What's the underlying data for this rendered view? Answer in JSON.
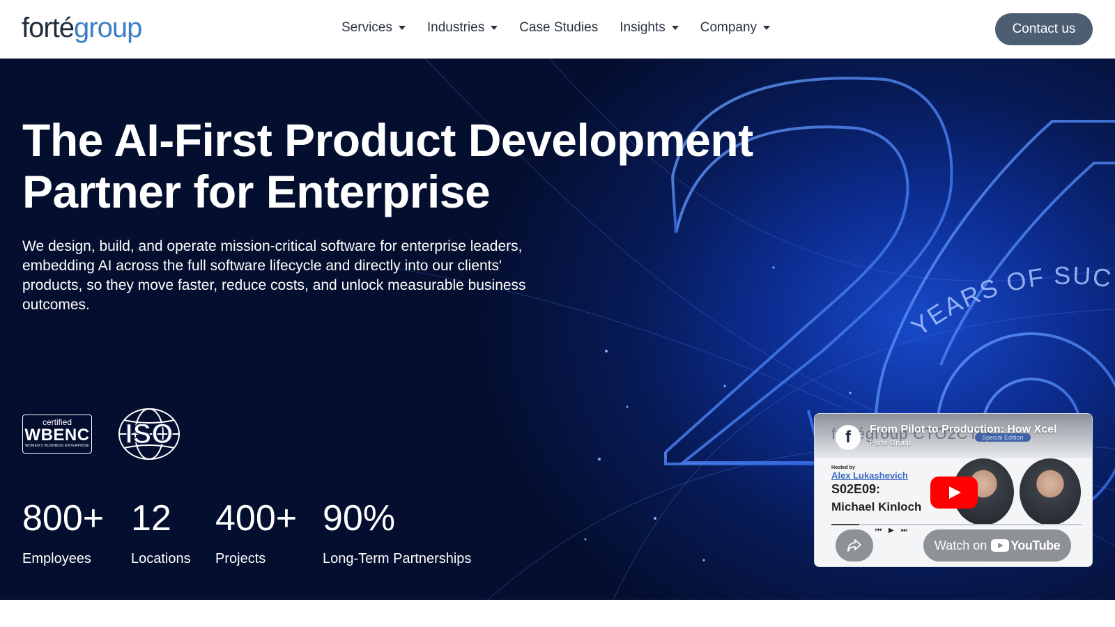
{
  "brand": {
    "logo_part1": "forté",
    "logo_part2": "group"
  },
  "nav": {
    "items": [
      {
        "label": "Services",
        "has_dropdown": true
      },
      {
        "label": "Industries",
        "has_dropdown": true
      },
      {
        "label": "Case Studies",
        "has_dropdown": false
      },
      {
        "label": "Insights",
        "has_dropdown": true
      },
      {
        "label": "Company",
        "has_dropdown": true
      }
    ],
    "contact_label": "Contact us"
  },
  "hero": {
    "headline_line1": "The AI-First Product Development",
    "headline_line2": "Partner for Enterprise",
    "subtext": "We design, build, and operate mission-critical software for enterprise leaders, embedding AI across the full software lifecycle and directly into our clients' products, so they move faster, reduce costs, and unlock measurable business outcomes.",
    "background_text": {
      "big_number": "26",
      "arc_text": "YEARS OF SUCCESS"
    }
  },
  "badges": {
    "wbenc": {
      "certified": "certified",
      "name": "WBENC",
      "subtitle": "WOMEN'S BUSINESS ENTERPRISE"
    },
    "iso": {
      "text": "ISO"
    }
  },
  "stats": [
    {
      "value": "800+",
      "label": "Employees"
    },
    {
      "value": "12",
      "label": "Locations"
    },
    {
      "value": "400+",
      "label": "Projects"
    },
    {
      "value": "90%",
      "label": "Long-Term Partnerships"
    }
  ],
  "video": {
    "title": "From Pilot to Production: How Xcel",
    "channel": "Forte Group",
    "channel_avatar_letter": "f",
    "background_brand": "fortégroup  CTO2CTO",
    "special_edition": "Special Edition",
    "hosted_by": "Hosted by",
    "host": "Alex Lukashevich",
    "episode": "S02E09:",
    "guest": "Michael Kinloch",
    "watch_on": "Watch on",
    "youtube": "YouTube",
    "progress_fraction": 0.11
  },
  "colors": {
    "brand_dark": "#1d2b3a",
    "brand_blue": "#3b7ec5",
    "contact_button": "#4d5d72",
    "hero_dark": "#040e2e",
    "hero_glow": "#1849c9",
    "youtube_red": "#ff0000"
  },
  "icons": [
    "chevron-down-icon",
    "play-icon",
    "share-icon",
    "youtube-icon",
    "globe-icon"
  ]
}
